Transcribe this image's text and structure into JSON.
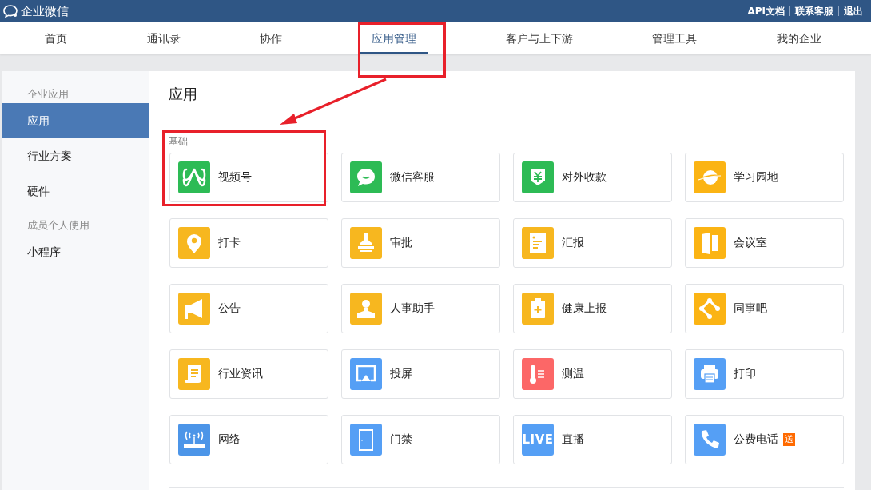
{
  "topbar": {
    "logo_text": "企业微信",
    "links": [
      "API文档",
      "联系客服",
      "退出"
    ]
  },
  "nav": {
    "tabs": [
      {
        "label": "首页",
        "selected": false,
        "highlighted": false
      },
      {
        "label": "通讯录",
        "selected": false,
        "highlighted": false
      },
      {
        "label": "协作",
        "selected": false,
        "highlighted": false
      },
      {
        "label": "应用管理",
        "selected": true,
        "highlighted": true
      },
      {
        "label": "客户与上下游",
        "selected": false,
        "highlighted": false
      },
      {
        "label": "管理工具",
        "selected": false,
        "highlighted": false
      },
      {
        "label": "我的企业",
        "selected": false,
        "highlighted": false
      }
    ]
  },
  "sidebar": {
    "groups": [
      {
        "heading": "企业应用",
        "items": [
          {
            "label": "应用",
            "selected": true
          },
          {
            "label": "行业方案",
            "selected": false
          },
          {
            "label": "硬件",
            "selected": false
          }
        ]
      },
      {
        "heading": "成员个人使用",
        "items": [
          {
            "label": "小程序",
            "selected": false
          }
        ]
      }
    ]
  },
  "main": {
    "title": "应用",
    "annotation_arrow": true,
    "section": {
      "label": "基础",
      "apps": [
        {
          "name": "视频号",
          "color": "#2dbb55",
          "highlighted": true
        },
        {
          "name": "微信客服",
          "color": "#2dbb55",
          "highlighted": false
        },
        {
          "name": "对外收款",
          "color": "#2dbb55",
          "highlighted": false
        },
        {
          "name": "学习园地",
          "color": "#fbb414",
          "highlighted": false
        },
        {
          "name": "打卡",
          "color": "#f7b71f",
          "highlighted": false
        },
        {
          "name": "审批",
          "color": "#f7b71f",
          "highlighted": false
        },
        {
          "name": "汇报",
          "color": "#f7b71f",
          "highlighted": false
        },
        {
          "name": "会议室",
          "color": "#fbb414",
          "highlighted": false
        },
        {
          "name": "公告",
          "color": "#f7b71f",
          "highlighted": false
        },
        {
          "name": "人事助手",
          "color": "#f7b71f",
          "highlighted": false
        },
        {
          "name": "健康上报",
          "color": "#f7b71f",
          "highlighted": false
        },
        {
          "name": "同事吧",
          "color": "#fbb414",
          "highlighted": false
        },
        {
          "name": "行业资讯",
          "color": "#f7b71f",
          "highlighted": false
        },
        {
          "name": "投屏",
          "color": "#559ff5",
          "highlighted": false
        },
        {
          "name": "测温",
          "color": "#fc6767",
          "highlighted": false
        },
        {
          "name": "打印",
          "color": "#559ff5",
          "highlighted": false
        },
        {
          "name": "网络",
          "color": "#4c95e8",
          "highlighted": false
        },
        {
          "name": "门禁",
          "color": "#559ff5",
          "highlighted": false
        },
        {
          "name": "直播",
          "color": "#559ff5",
          "highlighted": false,
          "icon_text": "LIVE"
        },
        {
          "name": "公费电话",
          "color": "#559ff5",
          "highlighted": false,
          "badge": "送"
        }
      ]
    }
  }
}
